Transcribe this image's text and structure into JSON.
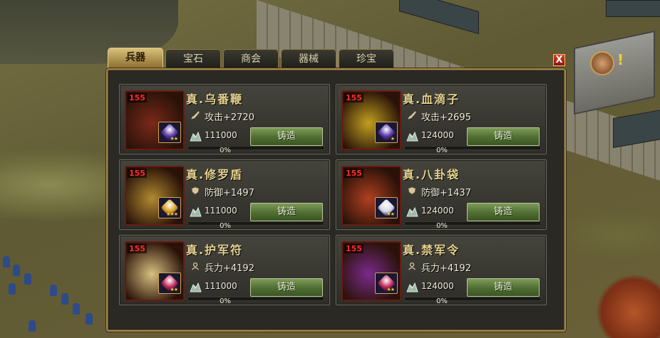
{
  "tabs": [
    {
      "label": "兵器",
      "active": true
    },
    {
      "label": "宝石",
      "active": false
    },
    {
      "label": "商会",
      "active": false
    },
    {
      "label": "器械",
      "active": false
    },
    {
      "label": "珍宝",
      "active": false
    }
  ],
  "close_label": "X",
  "items": [
    {
      "level": "155",
      "name": "真.乌番鞭",
      "stat_icon": "sword-icon",
      "stat": "攻击+2720",
      "cost": "111000",
      "button": "铸造",
      "progress": "0%",
      "stars": "★★",
      "gem_color": "#5a3aa8",
      "art_color": "#7a2a1a"
    },
    {
      "level": "155",
      "name": "真.血滴子",
      "stat_icon": "sword-icon",
      "stat": "攻击+2695",
      "cost": "124000",
      "button": "铸造",
      "progress": "0%",
      "stars": "★",
      "gem_color": "#5a3aa8",
      "art_color": "#c0a020"
    },
    {
      "level": "155",
      "name": "真.修罗盾",
      "stat_icon": "shield-icon",
      "stat": "防御+1497",
      "cost": "111000",
      "button": "铸造",
      "progress": "0%",
      "stars": "★★★",
      "gem_color": "#d8a020",
      "art_color": "#b08a30"
    },
    {
      "level": "155",
      "name": "真.八卦袋",
      "stat_icon": "shield-icon",
      "stat": "防御+1437",
      "cost": "124000",
      "button": "铸造",
      "progress": "0%",
      "stars": "★★",
      "gem_color": "#d0d8e8",
      "art_color": "#b04020"
    },
    {
      "level": "155",
      "name": "真.护军符",
      "stat_icon": "soldier-icon",
      "stat": "兵力+4192",
      "cost": "111000",
      "button": "铸造",
      "progress": "0%",
      "stars": "★★",
      "gem_color": "#c02a5a",
      "art_color": "#d8c080"
    },
    {
      "level": "155",
      "name": "真.禁军令",
      "stat_icon": "soldier-icon",
      "stat": "兵力+4192",
      "cost": "124000",
      "button": "铸造",
      "progress": "0%",
      "stars": "★★",
      "gem_color": "#c02a5a",
      "art_color": "#7a2a8a"
    }
  ]
}
